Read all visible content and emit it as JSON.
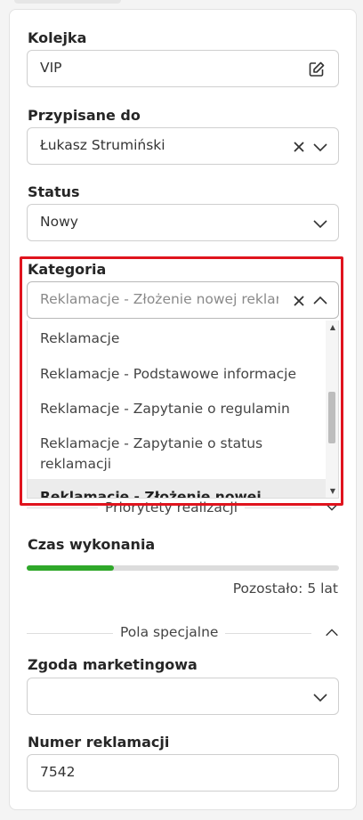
{
  "form": {
    "queue": {
      "label": "Kolejka",
      "value": "VIP",
      "edit_icon": "edit-icon"
    },
    "assigned": {
      "label": "Przypisane do",
      "value": "Łukasz Strumiński"
    },
    "status": {
      "label": "Status",
      "value": "Nowy"
    },
    "category": {
      "label": "Kategoria",
      "value": "Reklamacje - Złożenie nowej reklamacji",
      "options": [
        "Reklamacje",
        "Reklamacje - Podstawowe informacje",
        "Reklamacje - Zapytanie o regulamin",
        "Reklamacje - Zapytanie o status reklamacji",
        "Reklamacje - Złożenie nowej"
      ],
      "selected_index": 4
    },
    "priorities_section": "Priorytety realizacji",
    "time": {
      "label": "Czas wykonania",
      "progress_percent": 28,
      "remaining": "Pozostało: 5 lat"
    },
    "special_section": "Pola specjalne",
    "consent": {
      "label": "Zgoda marketingowa",
      "value": ""
    },
    "complaint_no": {
      "label": "Numer reklamacji",
      "value": "7542"
    }
  },
  "colors": {
    "accent_green": "#2fa82a",
    "highlight_red": "#e0141e"
  }
}
